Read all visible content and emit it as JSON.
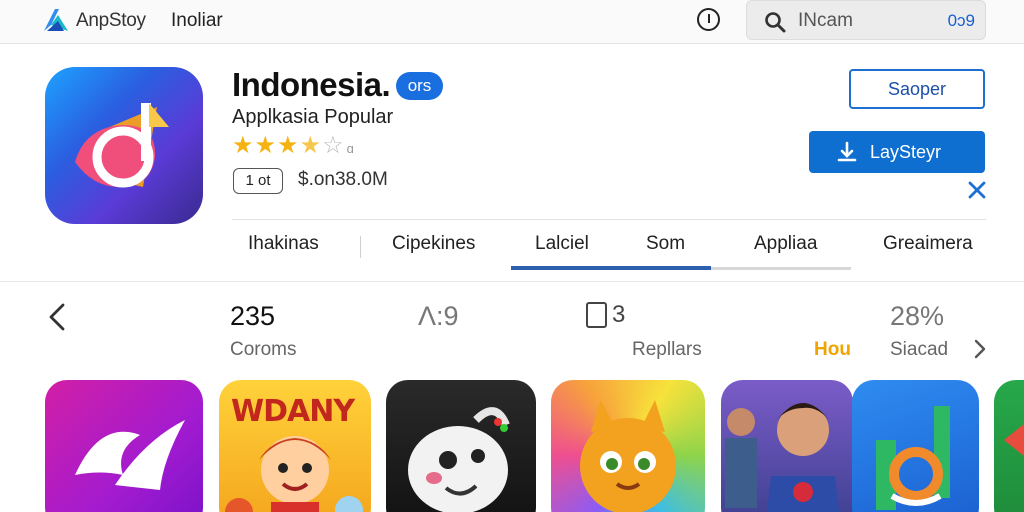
{
  "topbar": {
    "brand_name": "AnpStoy",
    "nav_label": "Inoliar",
    "search_placeholder": "INcam",
    "search_code": "0ɔ9",
    "icons": [
      "brand-logo-icon",
      "info-icon",
      "search-icon"
    ]
  },
  "app": {
    "title": "Indonesia.",
    "badge": "ors",
    "subtitle": "Applkasia Popular",
    "rating": {
      "stars_filled": 3.5,
      "stars_total": 5
    },
    "age_badge": "1 ot",
    "size_text": "$.on38.0M",
    "secondary_button": "Saoper",
    "primary_button": "LaySteyr"
  },
  "tabs": [
    {
      "label": "Ihakinas"
    },
    {
      "label": "Cipekines"
    },
    {
      "label": "Lalciel",
      "active": true
    },
    {
      "label": "Som"
    },
    {
      "label": "Appliaa"
    },
    {
      "label": "Greaimera"
    }
  ],
  "stats": [
    {
      "value": "235",
      "label": "Coroms"
    },
    {
      "value": "Λ:9",
      "label": ""
    },
    {
      "value": "3",
      "label": "Repllars"
    },
    {
      "value": "",
      "label": "Hou"
    },
    {
      "value": "28%",
      "label": "Siacad"
    }
  ],
  "gallery": [
    {
      "name": "magenta-app",
      "text": ""
    },
    {
      "name": "cartoon-game",
      "text": "WDANY"
    },
    {
      "name": "white-creature-game",
      "text": ""
    },
    {
      "name": "orange-cat-game",
      "text": ""
    },
    {
      "name": "hero-game",
      "text": ""
    },
    {
      "name": "blue-app",
      "text": ""
    },
    {
      "name": "green-app",
      "text": ""
    }
  ],
  "colors": {
    "accent": "#0f6fd0",
    "star": "#f5b312",
    "highlight": "#f0a400",
    "tab_active": "#2c5fae"
  }
}
